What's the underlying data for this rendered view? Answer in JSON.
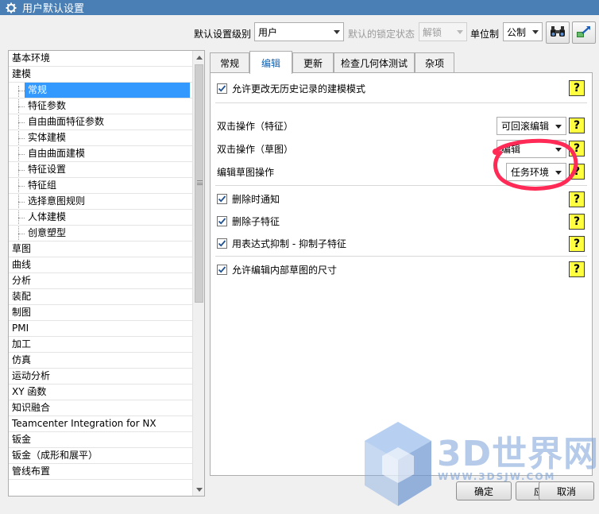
{
  "window": {
    "title": "用户默认设置"
  },
  "toolbar": {
    "level_label": "默认设置级别",
    "level_value": "用户",
    "lock_label": "默认的锁定状态",
    "lock_value": "解锁",
    "unit_label": "单位制",
    "unit_value": "公制"
  },
  "tree": {
    "items": [
      {
        "label": "基本环境",
        "level": 0
      },
      {
        "label": "建模",
        "level": 0
      },
      {
        "label": "常规",
        "level": 1,
        "selected": true
      },
      {
        "label": "特征参数",
        "level": 1
      },
      {
        "label": "自由曲面特征参数",
        "level": 1
      },
      {
        "label": "实体建模",
        "level": 1
      },
      {
        "label": "自由曲面建模",
        "level": 1
      },
      {
        "label": "特征设置",
        "level": 1
      },
      {
        "label": "特征组",
        "level": 1
      },
      {
        "label": "选择意图规则",
        "level": 1
      },
      {
        "label": "人体建模",
        "level": 1
      },
      {
        "label": "创意塑型",
        "level": 1
      },
      {
        "label": "草图",
        "level": 0
      },
      {
        "label": "曲线",
        "level": 0
      },
      {
        "label": "分析",
        "level": 0
      },
      {
        "label": "装配",
        "level": 0
      },
      {
        "label": "制图",
        "level": 0
      },
      {
        "label": "PMI",
        "level": 0
      },
      {
        "label": "加工",
        "level": 0
      },
      {
        "label": "仿真",
        "level": 0
      },
      {
        "label": "运动分析",
        "level": 0
      },
      {
        "label": "XY 函数",
        "level": 0
      },
      {
        "label": "知识融合",
        "level": 0
      },
      {
        "label": "Teamcenter Integration for NX",
        "level": 0
      },
      {
        "label": "钣金",
        "level": 0
      },
      {
        "label": "钣金（成形和展平）",
        "level": 0
      },
      {
        "label": "管线布置",
        "level": 0
      }
    ]
  },
  "tabs": [
    {
      "label": "常规"
    },
    {
      "label": "编辑",
      "active": true
    },
    {
      "label": "更新"
    },
    {
      "label": "检查几何体测试"
    },
    {
      "label": "杂项"
    }
  ],
  "options": {
    "allow_no_history": "允许更改无历史记录的建模模式",
    "double_click_feature_label": "双击操作（特征）",
    "double_click_feature_value": "可回滚编辑",
    "double_click_sketch_label": "双击操作（草图）",
    "double_click_sketch_value": "编辑",
    "edit_sketch_label": "编辑草图操作",
    "edit_sketch_value": "任务环境",
    "notify_on_delete": "删除时通知",
    "delete_children": "删除子特征",
    "expression_suppress": "用表达式抑制 - 抑制子特征",
    "allow_edit_internal_sketch_dims": "允许编辑内部草图的尺寸",
    "help_glyph": "?"
  },
  "buttons": {
    "ok": "确定",
    "apply": "应用",
    "cancel": "取消"
  },
  "watermark": {
    "text": "3D世界网",
    "url": "WWW.3DSJW.COM"
  },
  "colors": {
    "titlebar": "#4a7fb5",
    "selection": "#3399ff",
    "help_bg": "#ffff40",
    "annotation": "#ff2a55"
  },
  "icons": [
    "gear-icon",
    "binoculars-icon",
    "import-arrow-icon",
    "checkmark-icon",
    "help-icon"
  ]
}
